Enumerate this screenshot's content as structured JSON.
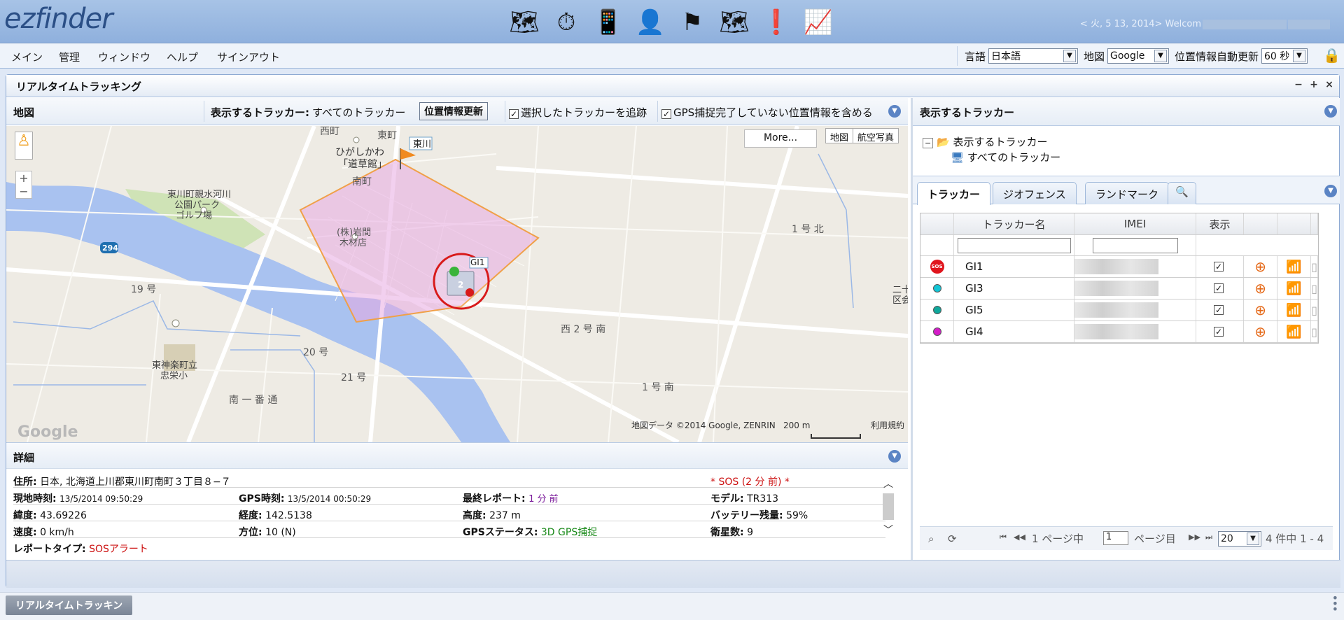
{
  "app": {
    "logo": "ezfinder",
    "welcome": "< 火, 5 13, 2014> Welcom"
  },
  "toolbar_icons": [
    {
      "name": "map-icon",
      "glyph": "🗺"
    },
    {
      "name": "stopwatch-icon",
      "glyph": "⏱"
    },
    {
      "name": "device-icon",
      "glyph": "📱"
    },
    {
      "name": "user-icon",
      "glyph": "👤"
    },
    {
      "name": "flag-icon",
      "glyph": "⚑"
    },
    {
      "name": "route-map-icon",
      "glyph": "🗺"
    },
    {
      "name": "alert-icon",
      "glyph": "❗"
    },
    {
      "name": "report-chart-icon",
      "glyph": "📈"
    }
  ],
  "menu": [
    "メイン",
    "管理",
    "ウィンドウ",
    "ヘルプ",
    "サインアウト"
  ],
  "settings": {
    "lang_label": "言語",
    "lang_value": "日本語",
    "map_label": "地図",
    "map_value": "Google",
    "refresh_label": "位置情報自動更新",
    "refresh_value": "60 秒"
  },
  "window": {
    "title": "リアルタイムトラッキング"
  },
  "maptoolbar": {
    "map_label": "地図",
    "trackers_label": "表示するトラッカー:",
    "trackers_value": "すべてのトラッカー",
    "update_button": "位置情報更新",
    "follow_label": "選択したトラッカーを追跡",
    "gps_label": "GPS捕捉完了していない位置情報を含める"
  },
  "map": {
    "more_button": "More...",
    "type_map": "地図",
    "type_aerial": "航空写真",
    "copyright": "地図データ ©2014 Google, ZENRIN",
    "scale": "200 m",
    "terms": "利用規約",
    "google": "Google",
    "labels": {
      "nishimachi": "西町",
      "higashimachi": "東町",
      "higashikawa_tag": "東川",
      "higashikawa_kana": "ひがしかわ",
      "michikusakan": "「道草館」",
      "minamimachi": "南町",
      "park1": "東川町親水河川",
      "park2": "公園パーク",
      "park3": "ゴルフ場",
      "iwama1": "(株)岩間",
      "iwama2": "木材店",
      "r294": "294",
      "go19": "19 号",
      "go20": "20 号",
      "go21": "21 号",
      "nishi2": "西 2 号 南",
      "ichigo_kita": "1 号 北",
      "ichigo_minami": "1 号 南",
      "minami1ban": "南 一 番 通",
      "school1": "東神楽町立",
      "school2": "忠栄小",
      "nijuu": "二十",
      "kyoukai": "区会",
      "gi1": "GI1",
      "cluster": "2"
    }
  },
  "details": {
    "title": "詳細",
    "address_label": "住所:",
    "address": "日本, 北海道上川郡東川町南町３丁目８−７",
    "sos": "* SOS (2 分 前) *",
    "local_time_label": "現地時刻:",
    "local_time": "13/5/2014 09:50:29",
    "gps_time_label": "GPS時刻:",
    "gps_time": "13/5/2014 00:50:29",
    "last_report_label": "最終レポート:",
    "last_report": "1 分 前",
    "model_label": "モデル:",
    "model": "TR313",
    "lat_label": "緯度:",
    "lat": "43.69226",
    "lon_label": "経度:",
    "lon": "142.5138",
    "alt_label": "高度:",
    "alt": "237 m",
    "battery_label": "バッテリー残量:",
    "battery": "59%",
    "speed_label": "速度:",
    "speed": "0 km/h",
    "heading_label": "方位:",
    "heading": "10 (N)",
    "gps_status_label": "GPSステータス:",
    "gps_status": "3D GPS捕捉",
    "sats_label": "衛星数:",
    "sats": "9",
    "report_type_label": "レポートタイプ:",
    "report_type": "SOSアラート"
  },
  "right": {
    "title": "表示するトラッカー",
    "tree_root": "表示するトラッカー",
    "tree_child": "すべてのトラッカー",
    "tabs": [
      "トラッカー",
      "ジオフェンス",
      "ランドマーク"
    ],
    "grid_headers": {
      "name": "トラッカー名",
      "imei": "IMEI",
      "show": "表示"
    },
    "rows": [
      {
        "name": "GI1",
        "badge": "SOS",
        "color": "#e0141c"
      },
      {
        "name": "GI3",
        "color": "#12c6d6"
      },
      {
        "name": "GI5",
        "color": "#0fa89c"
      },
      {
        "name": "GI4",
        "color": "#d41cc8"
      }
    ],
    "pager": {
      "page_prefix": "1 ページ中",
      "page_value": "1",
      "page_suffix": "ページ目",
      "per_page": "20",
      "count": "4 件中 1 - 4"
    }
  },
  "taskbar": {
    "button": "リアルタイムトラッキン"
  }
}
